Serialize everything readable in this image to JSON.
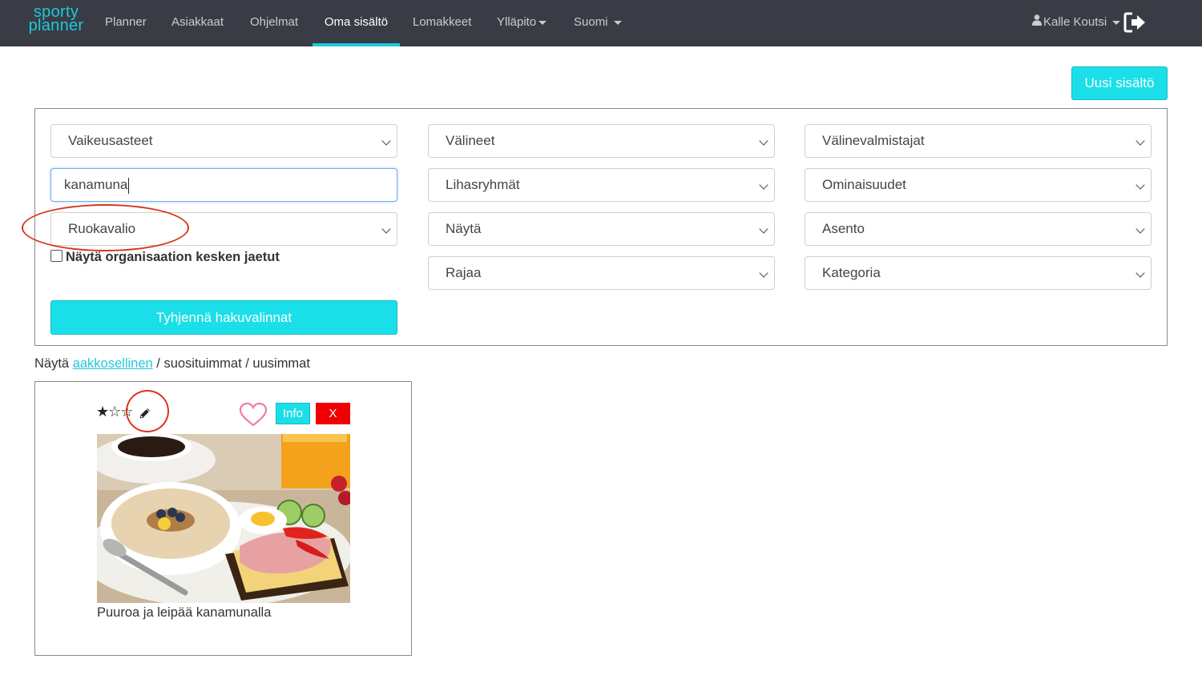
{
  "brand": {
    "line1": "sporty",
    "line2": "planner",
    "accent_color": "#1ec9dd"
  },
  "nav": {
    "items": [
      {
        "label": "Planner"
      },
      {
        "label": "Asiakkaat"
      },
      {
        "label": "Ohjelmat"
      },
      {
        "label": "Oma sisältö",
        "active": true
      },
      {
        "label": "Lomakkeet"
      },
      {
        "label": "Ylläpito",
        "dropdown": true
      },
      {
        "label": "Suomi",
        "dropdown": true
      }
    ],
    "user_name": "Kalle Koutsi",
    "user_icon": "user-icon",
    "logout_icon": "sign-out-icon"
  },
  "actions": {
    "new_content": "Uusi sisältö"
  },
  "filters": {
    "difficulty": "Vaikeusasteet",
    "equipment": "Välineet",
    "manufacturers": "Välinevalmistajat",
    "search_value": "kanamuna",
    "muscle_groups": "Lihasryhmät",
    "properties": "Ominaisuudet",
    "content_type": "Ruokavalio",
    "show": "Näytä",
    "position": "Asento",
    "limit": "Rajaa",
    "category": "Kategoria",
    "org_shared_label": "Näytä organisaation kesken jaetut",
    "org_shared_checked": false,
    "clear_button": "Tyhjennä hakuvalinnat"
  },
  "sort": {
    "prefix": "Näytä",
    "alphabetical": "aakkosellinen",
    "sep1": " / ",
    "popular": "suosituimmat",
    "sep2": " / ",
    "newest": "uusimmat"
  },
  "cards": [
    {
      "title": "Puuroa ja leipää kanamunalla",
      "rating_stars": "★☆☆",
      "rating": 1,
      "rating_max": 3,
      "edit_icon": "pencil-icon",
      "favorite_icon": "heart-icon",
      "info_label": "Info",
      "delete_label": "X"
    }
  ],
  "colors": {
    "navbar": "#393c45",
    "accent": "#1bdfe8",
    "delete": "#f00000",
    "annotation": "#d9351c"
  }
}
